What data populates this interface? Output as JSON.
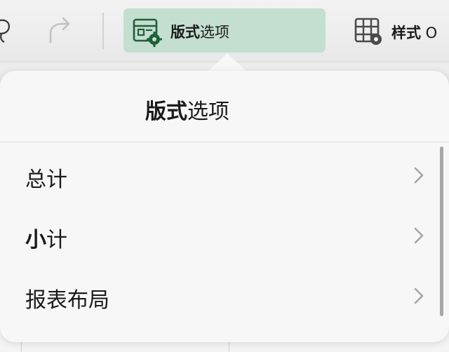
{
  "toolbar": {
    "undo_icon": "lasso-icon",
    "redo_icon": "redo-icon",
    "layout_options": {
      "label_bold": "版式",
      "label_rest": "选项",
      "icon": "table-layout-gear-icon",
      "accent": "#c4dfcf"
    },
    "styles": {
      "label_bold": "样式",
      "label_rest": " O",
      "icon": "grid-gear-icon"
    }
  },
  "popover": {
    "title_bold": "版式",
    "title_rest": "选项",
    "items": [
      {
        "bold": "",
        "text": "总计"
      },
      {
        "bold": "小",
        "text": "计"
      },
      {
        "bold": "",
        "text": "报表布局"
      }
    ]
  }
}
